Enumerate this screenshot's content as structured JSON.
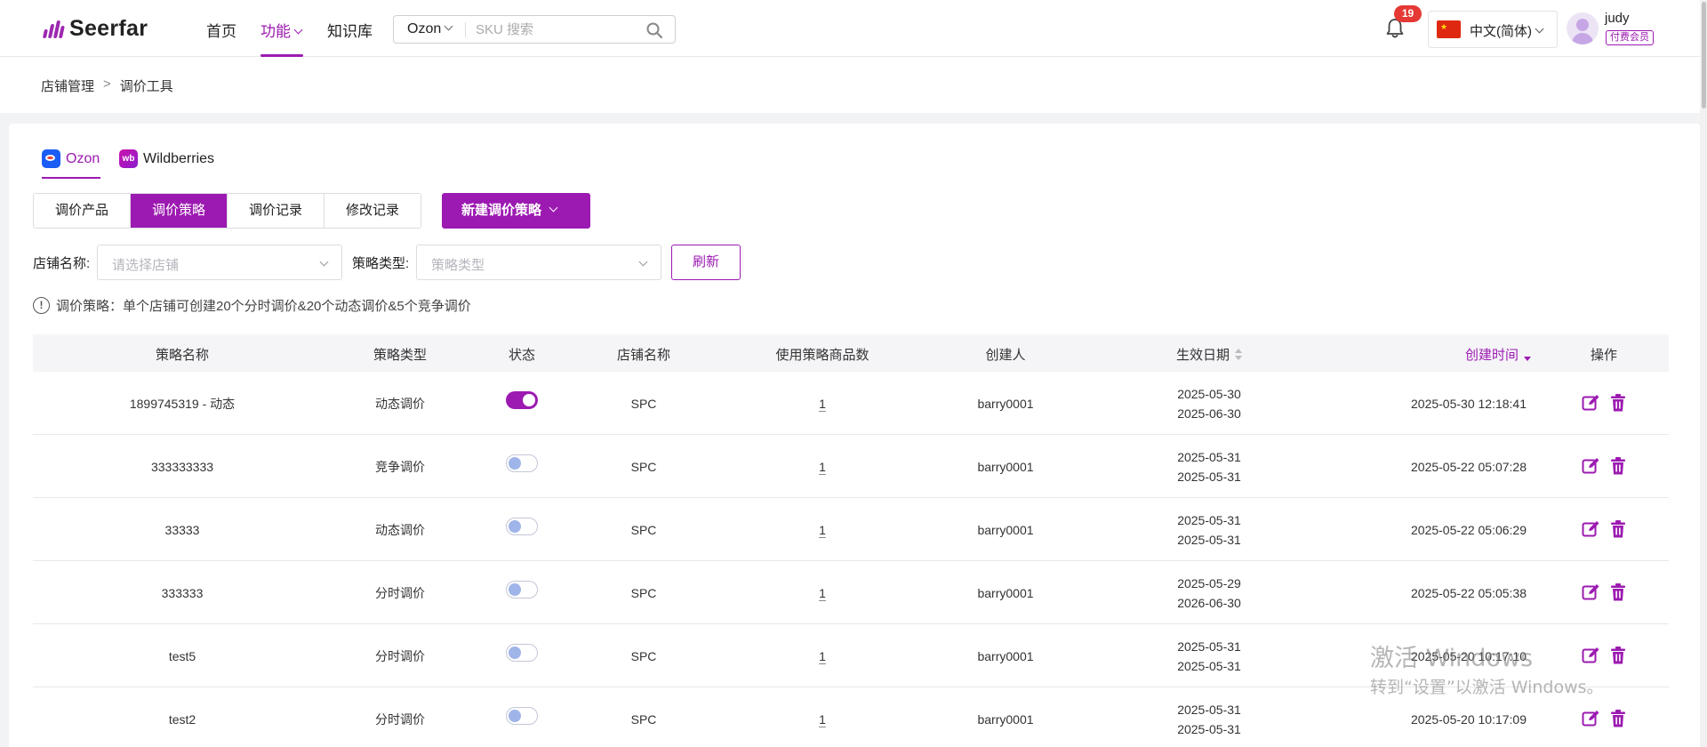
{
  "app": {
    "brand": "Seerfar",
    "brand_color": "#9c1ab1"
  },
  "nav": {
    "items": [
      {
        "label": "首页"
      },
      {
        "label": "功能"
      },
      {
        "label": "知识库"
      }
    ],
    "active": "功能"
  },
  "search": {
    "platform": "Ozon",
    "placeholder": "SKU 搜索",
    "value": ""
  },
  "header": {
    "notification_count": "19",
    "language": "中文(简体)",
    "flag_icon": "china-flag-icon",
    "username": "judy",
    "member_tag": "付费会员"
  },
  "breadcrumb": {
    "items": [
      "店铺管理",
      "调价工具"
    ],
    "separator": ">"
  },
  "platform_tabs": [
    {
      "label": "Ozon",
      "icon": "ozon-logo-icon",
      "active": true
    },
    {
      "label": "Wildberries",
      "icon": "wildberries-logo-icon",
      "active": false
    }
  ],
  "sub_tabs": [
    {
      "label": "调价产品"
    },
    {
      "label": "调价策略"
    },
    {
      "label": "调价记录"
    },
    {
      "label": "修改记录"
    }
  ],
  "active_sub_tab": "调价策略",
  "new_strategy_button": "新建调价策略",
  "filters": {
    "shop_label": "店铺名称:",
    "shop_placeholder": "请选择店铺",
    "type_label": "策略类型:",
    "type_placeholder": "策略类型",
    "refresh_label": "刷新"
  },
  "notice": "调价策略：单个店铺可创建20个分时调价&20个动态调价&5个竞争调价",
  "table": {
    "columns": [
      "策略名称",
      "策略类型",
      "状态",
      "店铺名称",
      "使用策略商品数",
      "创建人",
      "生效日期",
      "创建时间",
      "操作"
    ],
    "sorted_column": "创建时间",
    "sort_direction": "desc",
    "rows": [
      {
        "name": "1899745319 - 动态",
        "type": "动态调价",
        "enabled": true,
        "shop": "SPC",
        "count": "1",
        "creator": "barry0001",
        "start": "2025-05-30",
        "end": "2025-06-30",
        "created": "2025-05-30 12:18:41"
      },
      {
        "name": "333333333",
        "type": "竞争调价",
        "enabled": false,
        "shop": "SPC",
        "count": "1",
        "creator": "barry0001",
        "start": "2025-05-31",
        "end": "2025-05-31",
        "created": "2025-05-22 05:07:28"
      },
      {
        "name": "33333",
        "type": "动态调价",
        "enabled": false,
        "shop": "SPC",
        "count": "1",
        "creator": "barry0001",
        "start": "2025-05-31",
        "end": "2025-05-31",
        "created": "2025-05-22 05:06:29"
      },
      {
        "name": "333333",
        "type": "分时调价",
        "enabled": false,
        "shop": "SPC",
        "count": "1",
        "creator": "barry0001",
        "start": "2025-05-29",
        "end": "2026-06-30",
        "created": "2025-05-22 05:05:38"
      },
      {
        "name": "test5",
        "type": "分时调价",
        "enabled": false,
        "shop": "SPC",
        "count": "1",
        "creator": "barry0001",
        "start": "2025-05-31",
        "end": "2025-05-31",
        "created": "2025-05-20 10:17:10"
      },
      {
        "name": "test2",
        "type": "分时调价",
        "enabled": false,
        "shop": "SPC",
        "count": "1",
        "creator": "barry0001",
        "start": "2025-05-31",
        "end": "2025-05-31",
        "created": "2025-05-20 10:17:09"
      }
    ]
  },
  "watermark": {
    "line1": "激活 Windows",
    "line2": "转到“设置”以激活 Windows。"
  }
}
